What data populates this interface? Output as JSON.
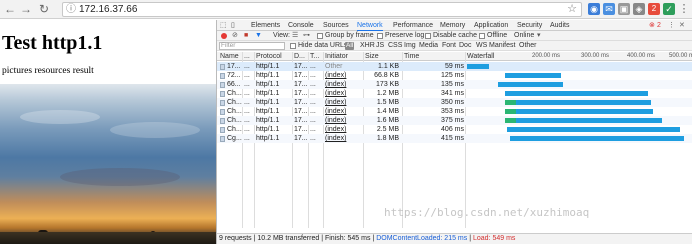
{
  "browser": {
    "url": "172.16.37.66",
    "extension_badge": "2"
  },
  "page": {
    "heading": "Test http1.1",
    "text": "pictures resources result"
  },
  "devtools": {
    "tabs": [
      "Elements",
      "Console",
      "Sources",
      "Network",
      "Performance",
      "Memory",
      "Application",
      "Security",
      "Audits"
    ],
    "active_tab": "Network",
    "error_count": "2",
    "toolbar": {
      "view_label": "View:",
      "group_by_frame": "Group by frame",
      "preserve_log": "Preserve log",
      "disable_cache": "Disable cache",
      "offline": "Offline",
      "throttle": "Online"
    },
    "filter": {
      "placeholder": "Filter",
      "hide_data_urls": "Hide data URLs",
      "all": "All",
      "types": [
        "XHR",
        "JS",
        "CSS",
        "Img",
        "Media",
        "Font",
        "Doc",
        "WS",
        "Manifest",
        "Other"
      ]
    },
    "columns": {
      "name": "Name",
      "dots": "...",
      "protocol": "Protocol",
      "d": "D...",
      "t": "T...",
      "initiator": "Initiator",
      "size": "Size",
      "time": "Time",
      "waterfall": "Waterfall"
    },
    "waterfall_ticks": [
      "200.00 ms",
      "300.00 ms",
      "400.00 ms",
      "500.00 ms"
    ],
    "rows": [
      {
        "name": "17...",
        "dots": "...",
        "protocol": "http/1.1",
        "d": "17...",
        "t": "...",
        "initiator": "Other",
        "size": "1.1 KB",
        "time": "59 ms",
        "wait_start": 0.0,
        "wait_dur": 0.0,
        "recv_start": 0.0,
        "recv_end": 0.1
      },
      {
        "name": "72...",
        "dots": "...",
        "protocol": "http/1.1",
        "d": "17...",
        "t": "...",
        "initiator": "(index)",
        "size": "66.8 KB",
        "time": "125 ms",
        "wait_start": 0.0,
        "wait_dur": 0.0,
        "recv_start": 0.17,
        "recv_end": 0.42
      },
      {
        "name": "66...",
        "dots": "...",
        "protocol": "http/1.1",
        "d": "17...",
        "t": "...",
        "initiator": "(index)",
        "size": "173 KB",
        "time": "135 ms",
        "wait_start": 0.0,
        "wait_dur": 0.0,
        "recv_start": 0.14,
        "recv_end": 0.43
      },
      {
        "name": "Ch...",
        "dots": "...",
        "protocol": "http/1.1",
        "d": "17...",
        "t": "...",
        "initiator": "(index)",
        "size": "1.2 MB",
        "time": "341 ms",
        "wait_start": 0.17,
        "wait_dur": 0.0,
        "recv_start": 0.17,
        "recv_end": 0.81
      },
      {
        "name": "Ch...",
        "dots": "...",
        "protocol": "http/1.1",
        "d": "17...",
        "t": "...",
        "initiator": "(index)",
        "size": "1.5 MB",
        "time": "350 ms",
        "wait_start": 0.17,
        "wait_dur": 0.05,
        "recv_start": 0.22,
        "recv_end": 0.82
      },
      {
        "name": "Ch...",
        "dots": "...",
        "protocol": "http/1.1",
        "d": "17...",
        "t": "...",
        "initiator": "(index)",
        "size": "1.4 MB",
        "time": "353 ms",
        "wait_start": 0.17,
        "wait_dur": 0.05,
        "recv_start": 0.22,
        "recv_end": 0.83
      },
      {
        "name": "Ch...",
        "dots": "...",
        "protocol": "http/1.1",
        "d": "17...",
        "t": "...",
        "initiator": "(index)",
        "size": "1.6 MB",
        "time": "375 ms",
        "wait_start": 0.17,
        "wait_dur": 0.05,
        "recv_start": 0.22,
        "recv_end": 0.87
      },
      {
        "name": "Ch...",
        "dots": "...",
        "protocol": "http/1.1",
        "d": "17...",
        "t": "...",
        "initiator": "(index)",
        "size": "2.5 MB",
        "time": "406 ms",
        "wait_start": 0.0,
        "wait_dur": 0.0,
        "recv_start": 0.18,
        "recv_end": 0.95
      },
      {
        "name": "Cg...",
        "dots": "...",
        "protocol": "http/1.1",
        "d": "17...",
        "t": "...",
        "initiator": "(index)",
        "size": "1.8 MB",
        "time": "415 ms",
        "wait_start": 0.0,
        "wait_dur": 0.0,
        "recv_start": 0.19,
        "recv_end": 0.97
      }
    ],
    "status": {
      "summary": "9 requests | 10.2 MB transferred | Finish: 545 ms | ",
      "dcl": "DOMContentLoaded: 215 ms",
      "sep": " | ",
      "load": "Load: 549 ms"
    },
    "colors": {
      "waiting": "#2bb673",
      "receiving": "#1e9ee0",
      "active_tab": "#1a73e8"
    }
  },
  "watermark": "https://blog.csdn.net/xuzhimoaq"
}
